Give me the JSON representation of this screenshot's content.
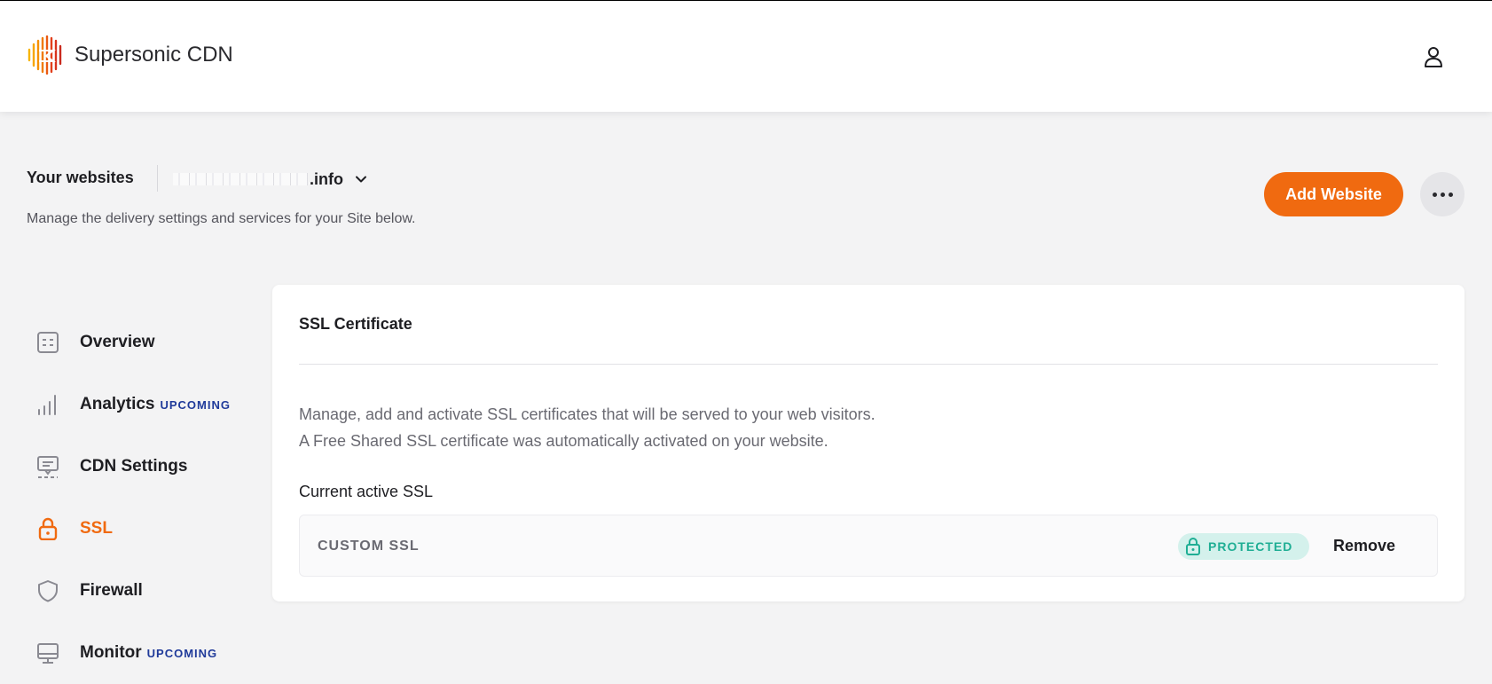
{
  "header": {
    "brand": "Supersonic CDN",
    "logo_icon": "supersonic-logo",
    "user_icon": "user-icon"
  },
  "site_bar": {
    "title": "Your websites",
    "site_name_visible": ".info",
    "subtitle": "Manage the delivery settings and services for your Site below.",
    "add_website_label": "Add Website",
    "more_icon": "more-horizontal-icon"
  },
  "sidebar": {
    "items": [
      {
        "label": "Overview",
        "icon": "overview-icon",
        "badge": "",
        "active": false
      },
      {
        "label": "Analytics",
        "icon": "analytics-icon",
        "badge": "UPCOMING",
        "active": false
      },
      {
        "label": "CDN Settings",
        "icon": "cdn-settings-icon",
        "badge": "",
        "active": false
      },
      {
        "label": "SSL",
        "icon": "lock-icon",
        "badge": "",
        "active": true
      },
      {
        "label": "Firewall",
        "icon": "shield-icon",
        "badge": "",
        "active": false
      },
      {
        "label": "Monitor",
        "icon": "monitor-icon",
        "badge": "UPCOMING",
        "active": false
      }
    ]
  },
  "ssl_card": {
    "title": "SSL Certificate",
    "description_line1": "Manage, add and activate SSL certificates that will be served to your web visitors.",
    "description_line2": "A Free Shared SSL certificate was automatically activated on your website.",
    "current_label": "Current active SSL",
    "ssl_type": "CUSTOM SSL",
    "status": "PROTECTED",
    "remove_label": "Remove"
  },
  "colors": {
    "accent": "#f06a10",
    "badge_blue": "#1f3a9a",
    "protected_green": "#1fae94",
    "protected_bg": "#d4f1ec"
  }
}
